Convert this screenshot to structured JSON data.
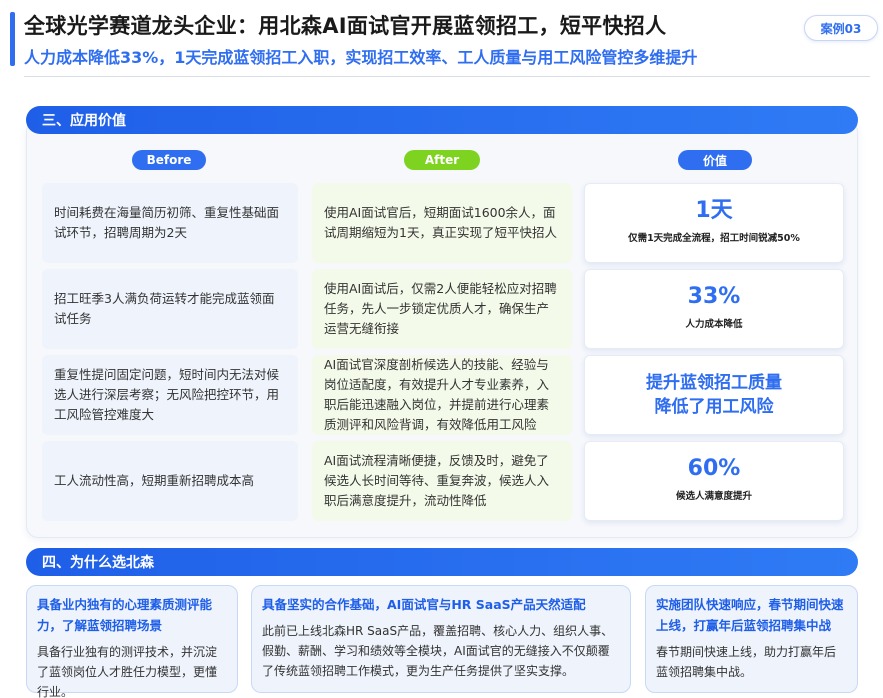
{
  "header": {
    "title": "全球光学赛道龙头企业：用北森AI面试官开展蓝领招工，短平快招人",
    "subtitle": "人力成本降低33%，1天完成蓝领招工入职，实现招工效率、工人质量与用工风险管控多维提升",
    "case_label": "案例03"
  },
  "section3": {
    "title": "三、应用价值",
    "columns": {
      "before": "Before",
      "after": "After",
      "value": "价值"
    },
    "rows": [
      {
        "before": "时间耗费在海量简历初筛、重复性基础面试环节，招聘周期为2天",
        "after": "使用AI面试官后，短期面试1600余人，面试周期缩短为1天，真正实现了短平快招人",
        "value_big": "1天",
        "value_desc": "仅需1天完成全流程，招工时间锐减50%"
      },
      {
        "before": "招工旺季3人满负荷运转才能完成蓝领面试任务",
        "after": "使用AI面试后，仅需2人便能轻松应对招聘任务，先人一步锁定优质人才，确保生产运营无缝衔接",
        "value_big": "33%",
        "value_desc": "人力成本降低"
      },
      {
        "before": "重复性提问固定问题，短时间内无法对候选人进行深层考察；无风险把控环节，用工风险管控难度大",
        "after": "AI面试官深度剖析候选人的技能、经验与岗位适配度，有效提升人才专业素养，入职后能迅速融入岗位，并提前进行心理素质测评和风险背调，有效降低用工风险",
        "value_big": "提升蓝领招工质量\n降低了用工风险",
        "value_desc": ""
      },
      {
        "before": "工人流动性高，短期重新招聘成本高",
        "after": "AI面试流程清晰便捷，反馈及时，避免了候选人长时间等待、重复奔波，候选人入职后满意度提升，流动性降低",
        "value_big": "60%",
        "value_desc": "候选人满意度提升"
      }
    ]
  },
  "section4": {
    "title": "四、为什么选北森",
    "cards": [
      {
        "title": "具备业内独有的心理素质测评能力，了解蓝领招聘场景",
        "body": "具备行业独有的测评技术，并沉淀了蓝领岗位人才胜任力模型，更懂行业。"
      },
      {
        "title": "具备坚实的合作基础，AI面试官与HR SaaS产品天然适配",
        "body": "此前已上线北森HR SaaS产品，覆盖招聘、核心人力、组织人事、假勤、薪酬、学习和绩效等全模块，AI面试官的无缝接入不仅颠覆了传统蓝领招聘工作模式，更为生产任务提供了坚实支撑。"
      },
      {
        "title": "实施团队快速响应，春节期间快速上线，打赢年后蓝领招聘集中战",
        "body": "春节期间快速上线，助力打赢年后蓝领招聘集中战。"
      }
    ]
  },
  "colors": {
    "brand_blue": "#2f6ef0",
    "after_green": "#7ed321"
  }
}
